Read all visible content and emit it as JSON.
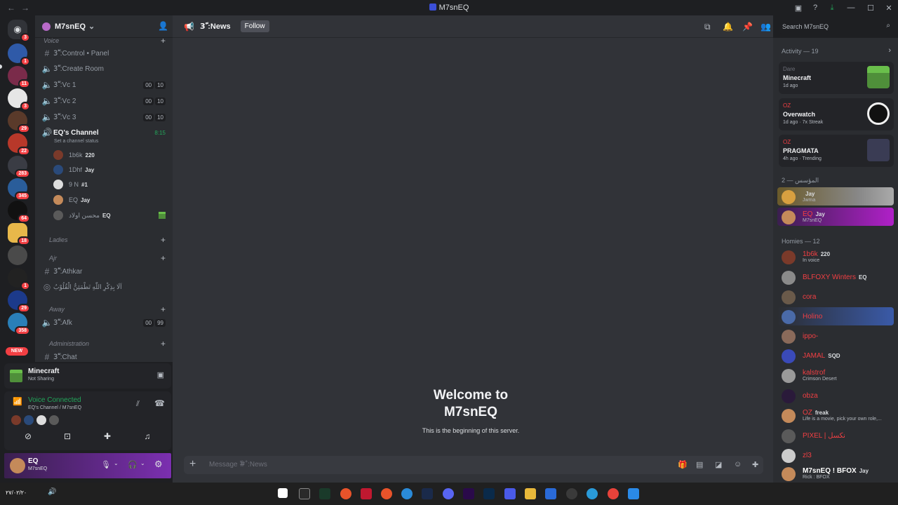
{
  "window": {
    "title": "M7snEQ"
  },
  "server": {
    "name": "M7snEQ"
  },
  "categories": [
    {
      "label": "Voice"
    },
    {
      "label": "Ladies"
    },
    {
      "label": "Ajr"
    },
    {
      "label": "Away"
    },
    {
      "label": "Administration"
    }
  ],
  "channels": [
    {
      "label": "3ّ˚:Control • Panel"
    },
    {
      "label": "3ّ˚:Create Room"
    },
    {
      "label": "3ّ˚:Vc 1",
      "c1": "00",
      "c2": "10"
    },
    {
      "label": "3ّ˚:Vc 2",
      "c1": "00",
      "c2": "10"
    },
    {
      "label": "3ّ˚:Vc 3",
      "c1": "00",
      "c2": "10"
    },
    {
      "label": "EQ's Channel",
      "time": "8:15",
      "status": "Set a channel status"
    },
    {
      "label": "3ّ˚:Athkar"
    },
    {
      "label": "اَلَا بِذِكْرِ اللّٰهِ تَطْمَئِنُّ الْقُلُوْبُ"
    },
    {
      "label": "3ّ˚:Afk",
      "c1": "00",
      "c2": "99"
    },
    {
      "label": "3ّ˚:Chat"
    }
  ],
  "voice_users": [
    {
      "name": "1b6k",
      "tag": "220"
    },
    {
      "name": "1Dhf",
      "tag": "Jay"
    },
    {
      "name": "9 N",
      "tag": "#1"
    },
    {
      "name": "EQ",
      "tag": "Jay"
    },
    {
      "name": "محسن اولاد",
      "tag": "EQ"
    }
  ],
  "activity_panel": {
    "game": "Minecraft",
    "status": "Not Sharing"
  },
  "voice_status": {
    "title": "Voice Connected",
    "location": "EQ's Channel / M7snEQ"
  },
  "user": {
    "name": "EQ",
    "status": "M7snEQ"
  },
  "header": {
    "channel_name": "3ّ˚:News",
    "follow_label": "Follow",
    "search_placeholder": "Search M7snEQ"
  },
  "welcome": {
    "title_line1": "Welcome to",
    "title_line2": "M7snEQ",
    "subtitle": "This is the beginning of this server."
  },
  "composer": {
    "placeholder": "Message #ّ˚:News"
  },
  "activity": {
    "header": "Activity — 19",
    "cards": [
      {
        "who": "Dare",
        "game": "Minecraft",
        "meta": "1d ago"
      },
      {
        "who": "OZ",
        "game": "Overwatch",
        "meta": "1d ago · 7x Streak"
      },
      {
        "who": "OZ",
        "game": "PRAGMATA",
        "meta": "4h ago · Trending"
      }
    ]
  },
  "member_groups": [
    {
      "label": "المؤسس — 2"
    },
    {
      "label": "Homies — 12"
    }
  ],
  "members": [
    {
      "name": "",
      "tag": "Jay",
      "status": "Jwma"
    },
    {
      "name": "EQ",
      "tag": "Jay",
      "status": "M7snEQ"
    },
    {
      "name": "1b6k",
      "tag": "220",
      "status": "In voice"
    },
    {
      "name": "BLFOXY Winters",
      "tag": "EQ",
      "status": ""
    },
    {
      "name": "cora",
      "tag": "",
      "status": ""
    },
    {
      "name": "Holino",
      "tag": "",
      "status": ""
    },
    {
      "name": "ippo-",
      "tag": "",
      "status": ""
    },
    {
      "name": "JAMAL",
      "tag": "SQD",
      "status": ""
    },
    {
      "name": "kalstrof",
      "tag": "",
      "status": "Crimson Desert"
    },
    {
      "name": "obza",
      "tag": "",
      "status": ""
    },
    {
      "name": "OZ",
      "tag": "freak",
      "status": "Life is a movie, pick your own role,..."
    },
    {
      "name": "PIXEL | نكسل",
      "tag": "",
      "status": ""
    },
    {
      "name": "zl3",
      "tag": "",
      "status": ""
    },
    {
      "name": "M7snEQ ! BFOX",
      "tag": "Jay",
      "status": "Rick : BFOX"
    }
  ],
  "guild_badges": [
    "3",
    "1",
    "11",
    "3",
    "29",
    "22",
    "283",
    "345",
    "64",
    "18",
    "1",
    "29",
    "358"
  ],
  "new_badge": "NEW",
  "taskbar": {
    "date": "٢٧/٠٢/٢٠"
  },
  "colors": {
    "accent": "#5865f2",
    "danger": "#f23f43",
    "online": "#23a55a"
  }
}
